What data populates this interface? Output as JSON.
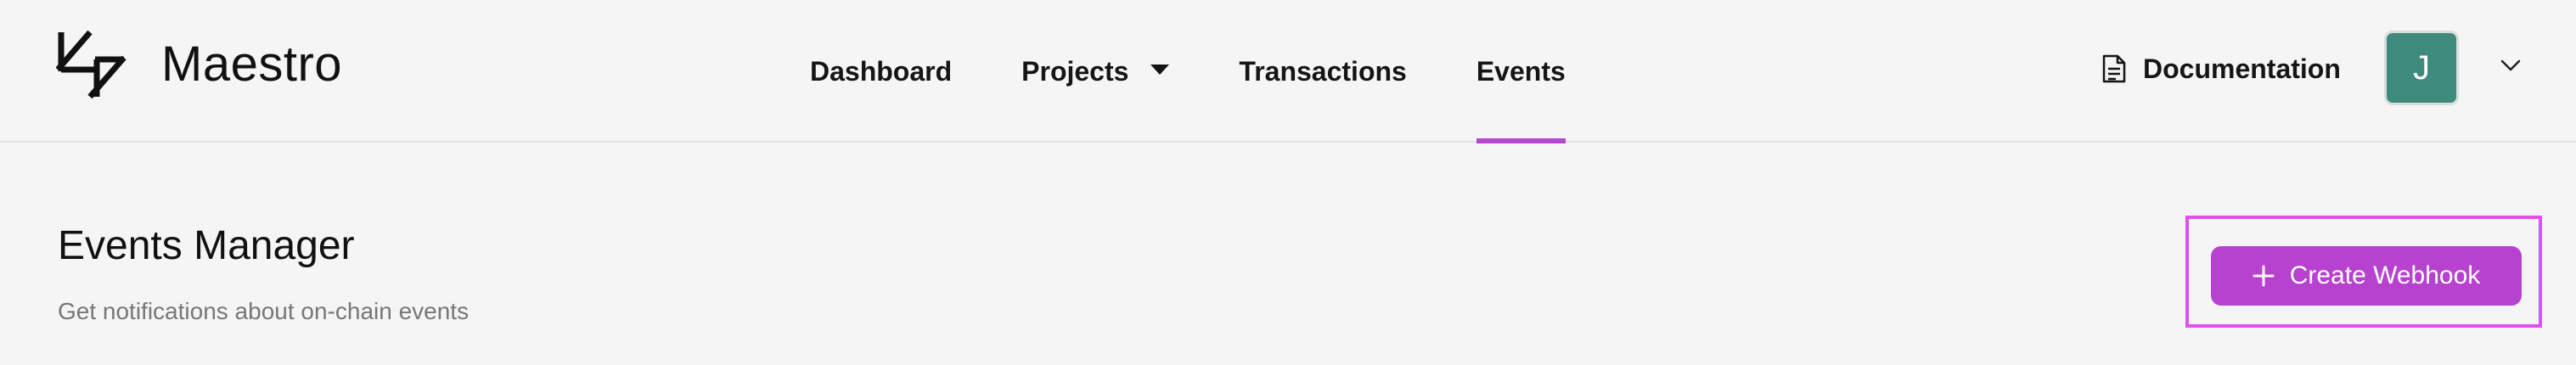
{
  "app": {
    "brand": "Maestro"
  },
  "nav": {
    "items": [
      {
        "label": "Dashboard"
      },
      {
        "label": "Projects"
      },
      {
        "label": "Transactions"
      },
      {
        "label": "Events"
      }
    ],
    "active": "Events"
  },
  "header_right": {
    "documentation_label": "Documentation",
    "avatar_initial": "J"
  },
  "main": {
    "title": "Events Manager",
    "subtitle": "Get notifications about on-chain events",
    "create_button_label": "Create Webhook"
  },
  "colors": {
    "accent": "#b642cf",
    "highlight": "#e24ef0",
    "avatar_bg": "#3e8a7c",
    "background": "#f5f5f5"
  },
  "icons": [
    "maestro-logo-icon",
    "caret-down-icon",
    "document-icon",
    "chevron-down-icon",
    "plus-icon"
  ]
}
